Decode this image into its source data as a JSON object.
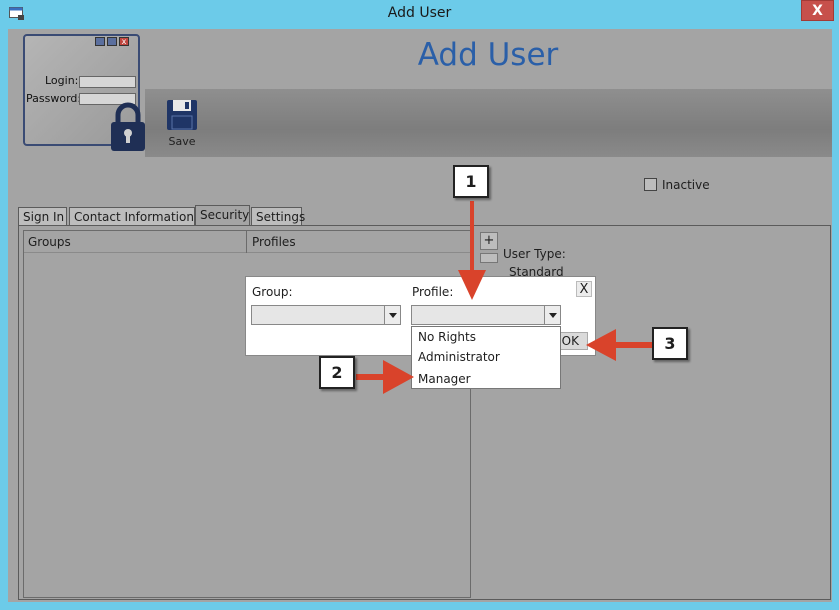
{
  "window": {
    "title": "Add User",
    "close_glyph": "X"
  },
  "header": {
    "app_title": "Add User"
  },
  "login_thumb": {
    "login_label": "Login:",
    "password_label": "Password:",
    "close_glyph": "x"
  },
  "toolbar": {
    "save_label": "Save"
  },
  "inactive": {
    "label": "Inactive"
  },
  "tabs": [
    {
      "label": "Sign In"
    },
    {
      "label": "Contact Information"
    },
    {
      "label": "Security"
    },
    {
      "label": "Settings"
    }
  ],
  "grid": {
    "columns": [
      "Groups",
      "Profiles"
    ]
  },
  "side": {
    "plus_glyph": "+",
    "user_type_label": "User Type:",
    "user_type_value": "Standard"
  },
  "dialog": {
    "group_label": "Group:",
    "profile_label": "Profile:",
    "close_glyph": "X",
    "ok_label": "OK"
  },
  "dropdown": {
    "options": [
      "No Rights",
      "Administrator",
      "Manager"
    ]
  },
  "callouts": [
    "1",
    "2",
    "3"
  ],
  "colors": {
    "accent_title": "#2a5fa8",
    "window_frame": "#6ccbe9",
    "arrow": "#d9432b"
  }
}
